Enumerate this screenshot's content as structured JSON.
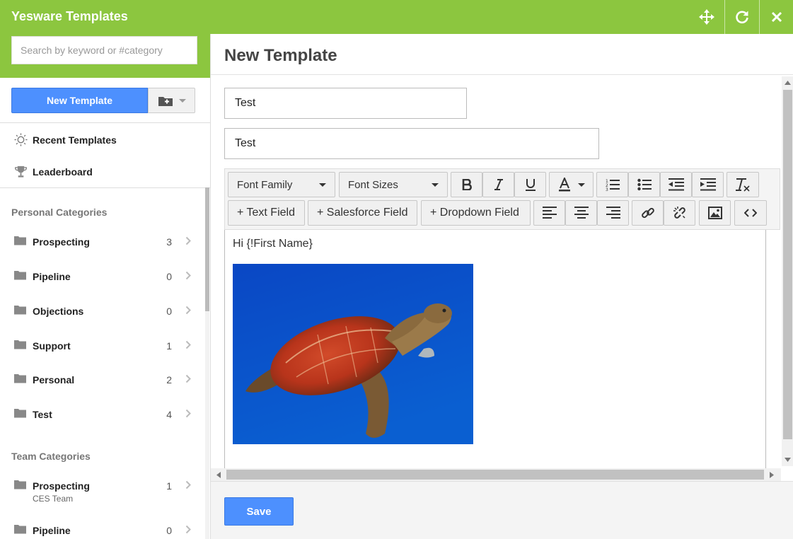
{
  "app": {
    "title": "Yesware Templates"
  },
  "window_controls": [
    {
      "name": "move-icon"
    },
    {
      "name": "refresh-icon"
    },
    {
      "name": "close-icon"
    }
  ],
  "search": {
    "placeholder": "Search by keyword or #category"
  },
  "actions": {
    "new_template_label": "New Template"
  },
  "nav": {
    "recent": "Recent Templates",
    "leaderboard": "Leaderboard"
  },
  "personal_categories": {
    "heading": "Personal Categories",
    "items": [
      {
        "name": "Prospecting",
        "count": "3"
      },
      {
        "name": "Pipeline",
        "count": "0"
      },
      {
        "name": "Objections",
        "count": "0"
      },
      {
        "name": "Support",
        "count": "1"
      },
      {
        "name": "Personal",
        "count": "2"
      },
      {
        "name": "Test",
        "count": "4"
      }
    ]
  },
  "team_categories": {
    "heading": "Team Categories",
    "items": [
      {
        "name": "Prospecting",
        "count": "1",
        "team": "CES Team"
      },
      {
        "name": "Pipeline",
        "count": "0"
      }
    ]
  },
  "editor": {
    "page_title": "New Template",
    "template_name": "Test",
    "subject": "Test",
    "font_family_label": "Font Family",
    "font_sizes_label": "Font Sizes",
    "text_field_label": "+ Text Field",
    "salesforce_field_label": "+ Salesforce Field",
    "dropdown_field_label": "+ Dropdown Field",
    "body_greeting": "Hi {!First Name}"
  },
  "footer": {
    "save_label": "Save"
  },
  "colors": {
    "brand_green": "#8cc63f",
    "primary_blue": "#4d90fe"
  }
}
